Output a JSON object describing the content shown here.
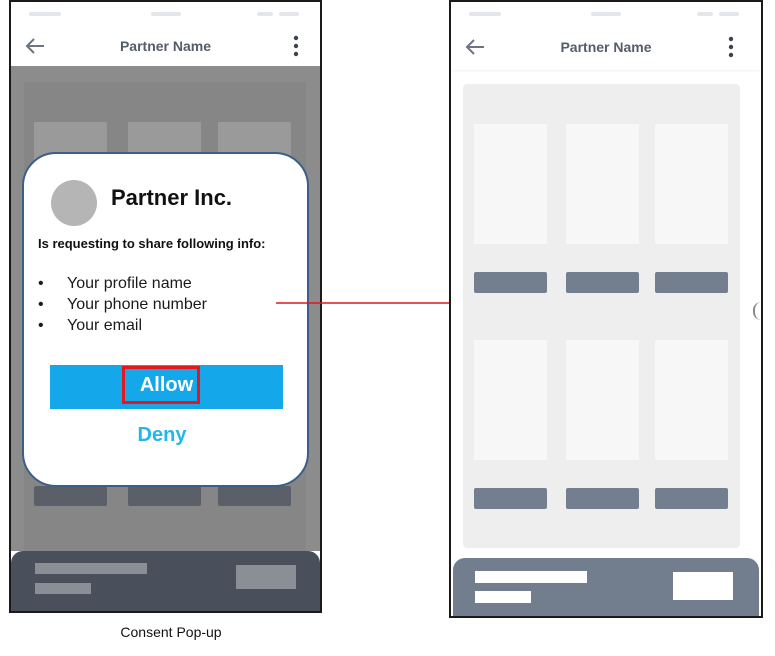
{
  "left_screen": {
    "header": {
      "title": "Partner Name",
      "back_icon": "arrow-left-icon",
      "menu_icon": "vertical-dots-icon"
    }
  },
  "right_screen": {
    "header": {
      "title": "Partner Name",
      "back_icon": "arrow-left-icon",
      "menu_icon": "vertical-dots-icon"
    }
  },
  "popup": {
    "partner_name": "Partner Inc.",
    "request_text": "Is requesting to share following info:",
    "items": [
      "Your profile name",
      "Your phone number",
      "Your email"
    ],
    "bullet": "•",
    "allow_label": "Allow",
    "deny_label": "Deny"
  },
  "caption": "Consent Pop-up",
  "colors": {
    "allow_button": "#14a7ea",
    "deny_text": "#21b7ec",
    "highlight": "#e2171f",
    "arrow": "#e2171f",
    "popup_border": "#3b5f86",
    "placeholder_bar": "#737f8f"
  }
}
